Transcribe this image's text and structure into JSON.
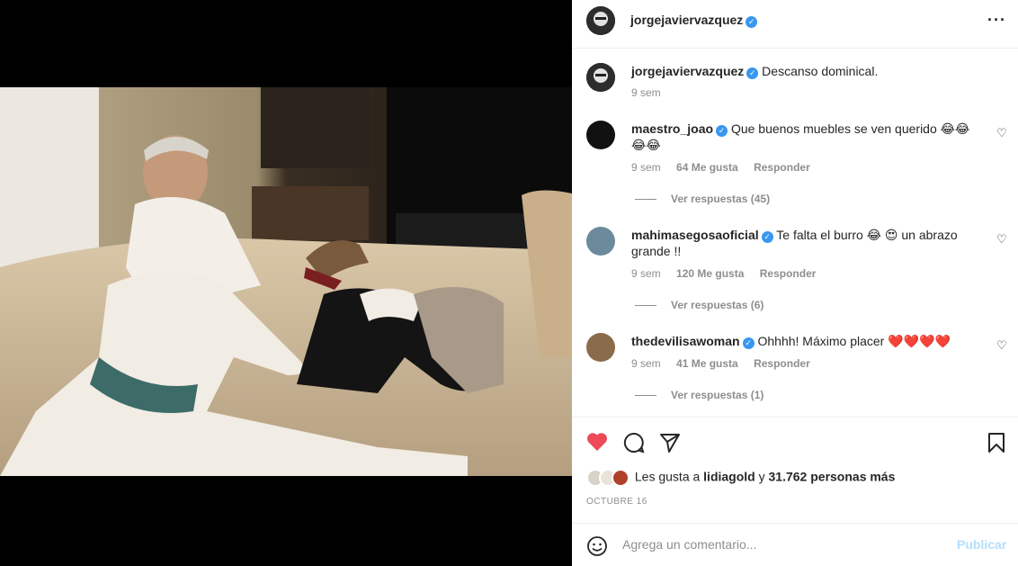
{
  "post": {
    "author": "jorgejaviervazquez",
    "more_icon": "more-options-icon",
    "caption": {
      "user": "jorgejaviervazquez",
      "text": "Descanso dominical.",
      "time": "9 sem"
    },
    "comments": [
      {
        "user": "maestro_joao",
        "text": "Que buenos muebles se ven querido 😂😂😂😂",
        "time": "9 sem",
        "likes": "64 Me gusta",
        "reply": "Responder",
        "view_replies": "Ver respuestas (45)"
      },
      {
        "user": "mahimasegosaoficial",
        "text": "Te falta el burro 😂 😍 un abrazo grande !!",
        "time": "9 sem",
        "likes": "120 Me gusta",
        "reply": "Responder",
        "view_replies": "Ver respuestas (6)"
      },
      {
        "user": "thedevilisawoman",
        "text": "Ohhhh! Máximo placer ❤️❤️❤️❤️",
        "time": "9 sem",
        "likes": "41 Me gusta",
        "reply": "Responder",
        "view_replies": "Ver respuestas (1)"
      }
    ],
    "likes_prefix": "Les gusta a",
    "likes_user": "lidiagold",
    "likes_and": "y",
    "likes_count": "31.762 personas más",
    "date": "OCTUBRE 16",
    "comment_placeholder": "Agrega un comentario...",
    "publish_label": "Publicar"
  },
  "colors": {
    "accent": "#3897f0",
    "like": "#ed4956",
    "publish_disabled": "#b2dffc"
  }
}
